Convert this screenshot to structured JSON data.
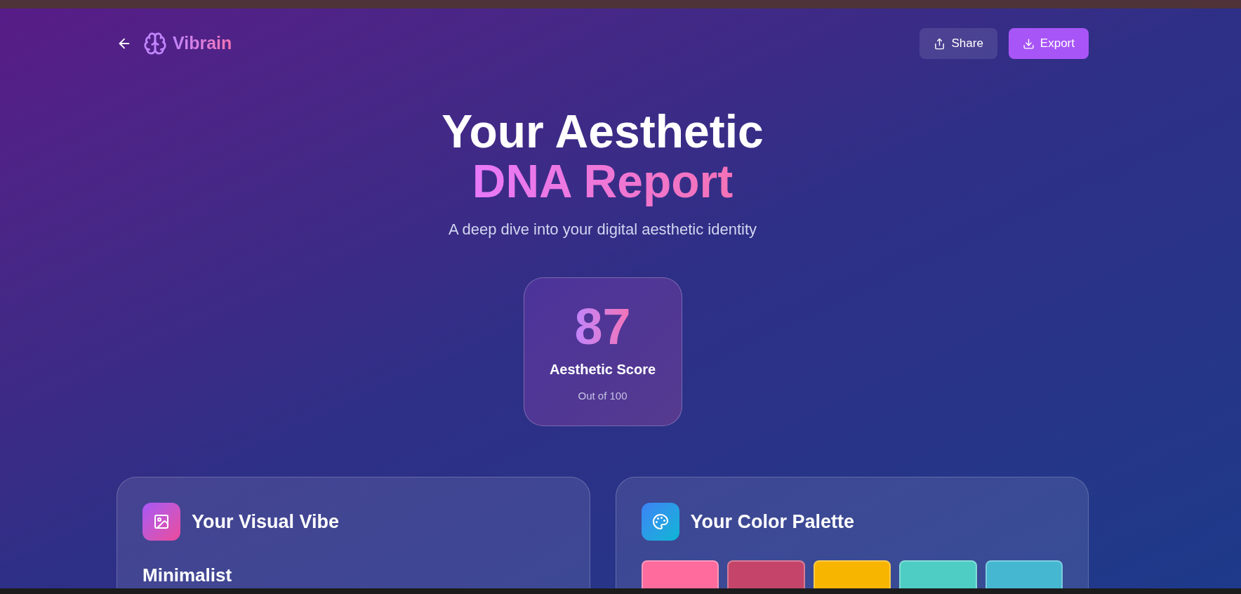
{
  "header": {
    "brand": "Vibrain",
    "actions": [
      {
        "label": "Share",
        "kind": "share"
      },
      {
        "label": "Export",
        "kind": "export"
      }
    ]
  },
  "hero": {
    "title_line1": "Your Aesthetic",
    "title_line2": "DNA Report",
    "subtitle": "A deep dive into your digital aesthetic identity"
  },
  "score": {
    "value": "87",
    "label": "Aesthetic Score",
    "caption": "Out of 100"
  },
  "cards": [
    {
      "kind": "vibe",
      "title": "Your Visual Vibe",
      "heading": "Minimalist"
    },
    {
      "kind": "palette",
      "title": "Your Color Palette",
      "swatches": [
        {
          "color": "#ff6b9d"
        },
        {
          "color": "#c44569"
        },
        {
          "color": "#f8b500"
        },
        {
          "color": "#4ecdc4"
        },
        {
          "color": "#45b7d1"
        }
      ]
    }
  ]
}
